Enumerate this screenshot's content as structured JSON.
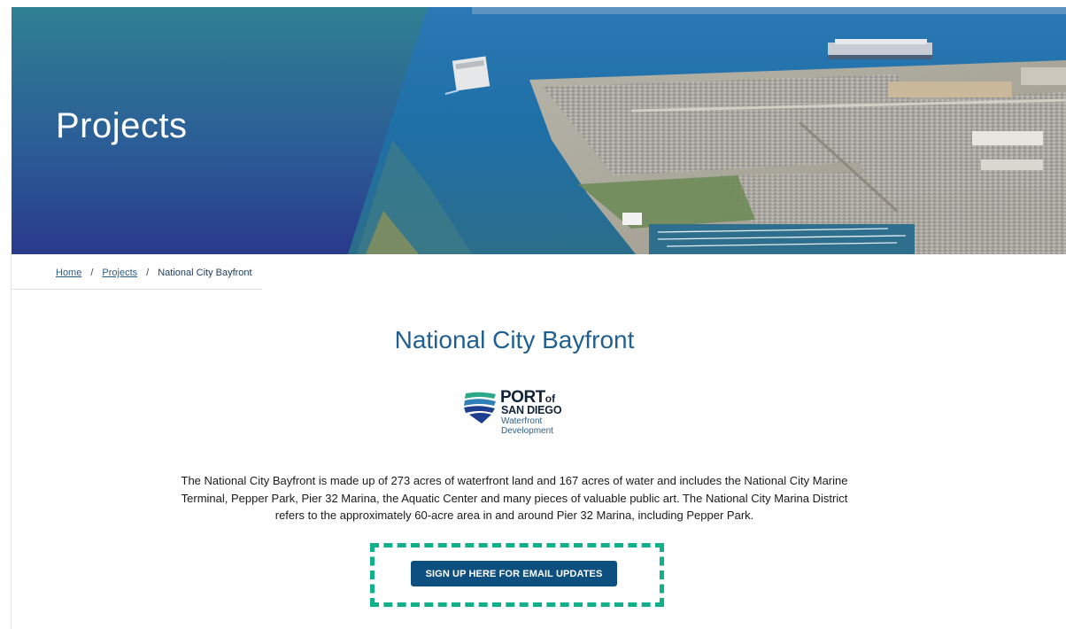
{
  "hero": {
    "title": "Projects"
  },
  "breadcrumb": {
    "items": [
      {
        "label": "Home"
      },
      {
        "label": "Projects"
      },
      {
        "label": "National City Bayfront"
      }
    ],
    "separator": "/"
  },
  "page": {
    "title": "National City Bayfront"
  },
  "logo": {
    "port": "PORT",
    "of": "of",
    "san_diego": "SAN DIEGO",
    "line1": "Waterfront",
    "line2": "Development"
  },
  "description": {
    "text": "The National City Bayfront is made up of 273 acres of waterfront land and 167 acres of water and includes the National City Marine Terminal, Pepper Park, Pier 32 Marina, the Aquatic Center and many pieces of valuable public art. The National City Marina District refers to the approximately 60-acre area in and around Pier 32 Marina, including Pepper Park."
  },
  "cta": {
    "label": "SIGN UP HERE FOR EMAIL UPDATES"
  },
  "colors": {
    "hero_gradient_top": "#2e7f8f",
    "hero_gradient_bottom": "#2b3f8e",
    "title_blue": "#1f5f91",
    "button_blue": "#0d4f7e",
    "highlight_green": "#12b08a"
  },
  "icons": {
    "logo_mark": "port-wave-logo-icon"
  }
}
